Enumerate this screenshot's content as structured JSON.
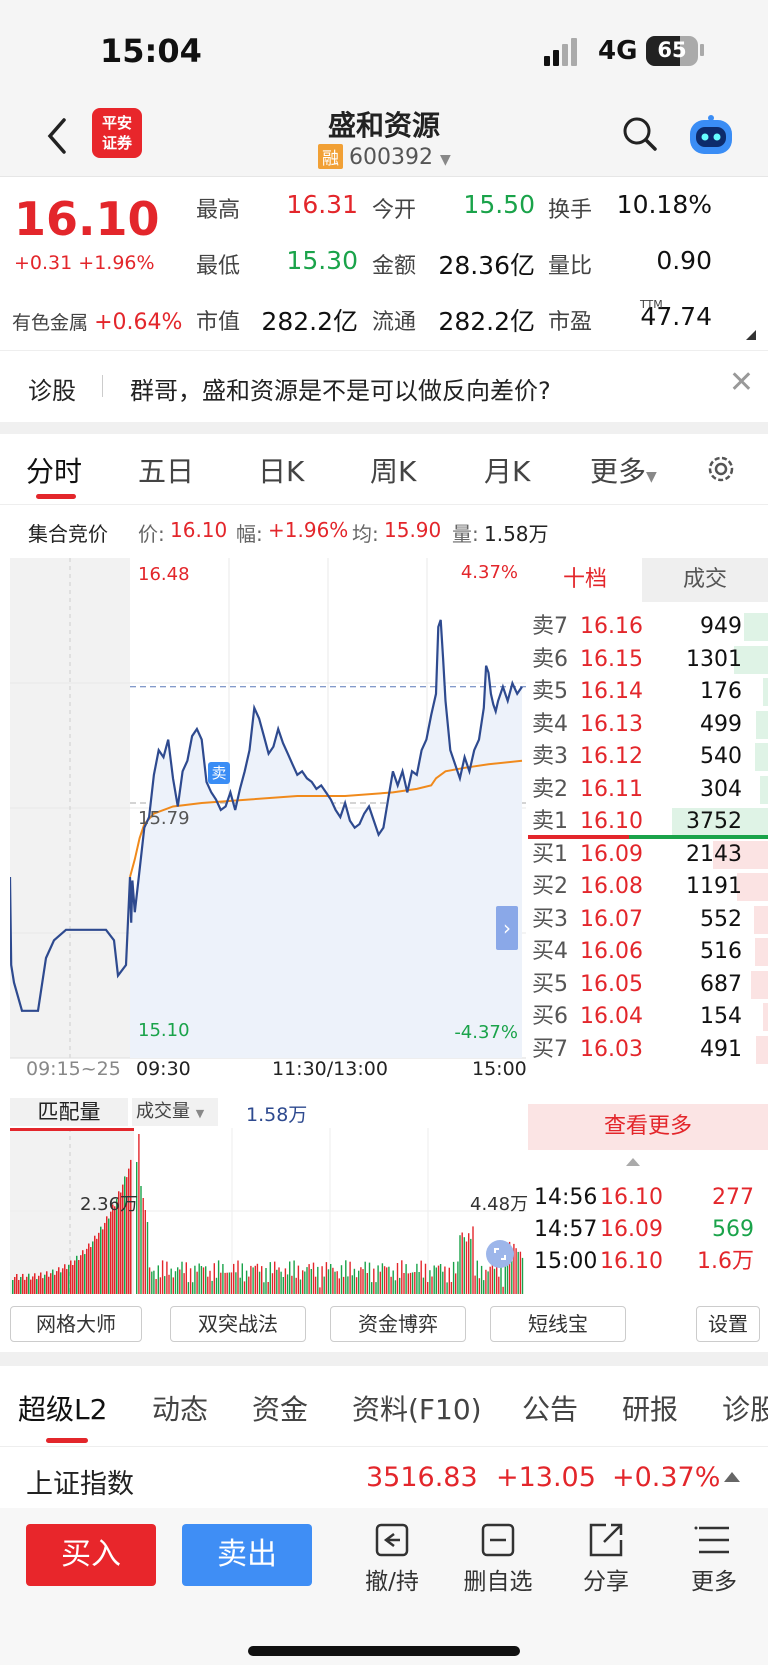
{
  "status_bar": {
    "time": "15:04",
    "network": "4G",
    "battery": "65",
    "battery_level_percent": 65
  },
  "header": {
    "stock_name": "盛和资源",
    "stock_code": "600392",
    "margin_badge": "融",
    "logo_text_line1": "平安",
    "logo_text_line2": "证券",
    "icons": [
      "back-arrow-icon",
      "search-icon",
      "robot-assistant-icon"
    ]
  },
  "quote": {
    "price": "16.10",
    "change": "+0.31",
    "change_pct": "+1.96%",
    "sector_name": "有色金属",
    "sector_change": "+0.64%",
    "fields": [
      {
        "label": "最高",
        "value": "16.31",
        "color": "red"
      },
      {
        "label": "今开",
        "value": "15.50",
        "color": "green"
      },
      {
        "label": "换手",
        "value": "10.18%",
        "color": "black"
      },
      {
        "label": "最低",
        "value": "15.30",
        "color": "green"
      },
      {
        "label": "金额",
        "value": "28.36亿",
        "color": "black"
      },
      {
        "label": "量比",
        "value": "0.90",
        "color": "black"
      },
      {
        "label": "市值",
        "value": "282.2亿",
        "color": "black"
      },
      {
        "label": "流通",
        "value": "282.2亿",
        "color": "black"
      },
      {
        "label": "市盈",
        "value": "47.74",
        "color": "black"
      }
    ],
    "pe_superscript": "TTM"
  },
  "hint": {
    "label": "诊股",
    "text": "群哥，盛和资源是不是可以做反向差价?"
  },
  "chart_tabs": [
    "分时",
    "五日",
    "日K",
    "周K",
    "月K",
    "更多"
  ],
  "auction": {
    "title": "集合竞价",
    "price_label": "价:",
    "price": "16.10",
    "range_label": "幅:",
    "range": "+1.96%",
    "avg_label": "均:",
    "avg": "15.90",
    "vol_label": "量:",
    "vol": "1.58万"
  },
  "chart_data": {
    "type": "line",
    "y_top_label": "16.48",
    "y_mid_label": "15.79",
    "y_bottom_label": "15.10",
    "pct_top_label": "4.37%",
    "pct_bottom_label": "-4.37%",
    "x_labels": [
      "09:15~25",
      "09:30",
      "11:30/13:00",
      "15:00"
    ],
    "ylim": [
      15.1,
      16.48
    ],
    "prev_close": 15.79,
    "marker_label": "卖",
    "price_series": [
      [
        0,
        15.58
      ],
      [
        0.3,
        15.33
      ],
      [
        1,
        15.28
      ],
      [
        3,
        15.2
      ],
      [
        7,
        15.2
      ],
      [
        9,
        15.35
      ],
      [
        11,
        15.4
      ],
      [
        14,
        15.43
      ],
      [
        20,
        15.43
      ],
      [
        24,
        15.43
      ],
      [
        26,
        15.4
      ],
      [
        27,
        15.3
      ],
      [
        29,
        15.33
      ],
      [
        30,
        15.58
      ],
      [
        30.5,
        15.45
      ],
      [
        31,
        15.57
      ],
      [
        32,
        15.48
      ],
      [
        34,
        15.6
      ],
      [
        36,
        15.72
      ],
      [
        38,
        15.75
      ],
      [
        40,
        15.87
      ],
      [
        42,
        15.94
      ],
      [
        44,
        15.92
      ],
      [
        46,
        15.97
      ],
      [
        48,
        15.86
      ],
      [
        50,
        15.78
      ],
      [
        52,
        15.88
      ],
      [
        54,
        15.91
      ],
      [
        56,
        15.98
      ],
      [
        58,
        16.0
      ],
      [
        60,
        15.97
      ],
      [
        62,
        15.85
      ],
      [
        64,
        15.82
      ],
      [
        66,
        15.8
      ],
      [
        68,
        15.77
      ],
      [
        70,
        15.78
      ],
      [
        72,
        15.82
      ],
      [
        74,
        15.77
      ],
      [
        76,
        15.83
      ],
      [
        78,
        15.88
      ],
      [
        80,
        15.94
      ],
      [
        82,
        16.06
      ],
      [
        84,
        16.03
      ],
      [
        86,
        15.98
      ],
      [
        88,
        15.93
      ],
      [
        90,
        15.95
      ],
      [
        92,
        16.0
      ],
      [
        94,
        15.96
      ],
      [
        96,
        15.93
      ],
      [
        98,
        15.9
      ],
      [
        100,
        15.87
      ],
      [
        102,
        15.88
      ],
      [
        104,
        15.86
      ],
      [
        106,
        15.85
      ],
      [
        108,
        15.83
      ],
      [
        110,
        15.84
      ],
      [
        112,
        15.82
      ],
      [
        114,
        15.8
      ],
      [
        116,
        15.77
      ],
      [
        118,
        15.75
      ],
      [
        120,
        15.79
      ],
      [
        122,
        15.74
      ],
      [
        124,
        15.72
      ],
      [
        126,
        15.73
      ],
      [
        128,
        15.76
      ],
      [
        130,
        15.78
      ],
      [
        132,
        15.74
      ],
      [
        134,
        15.7
      ],
      [
        136,
        15.72
      ],
      [
        138,
        15.8
      ],
      [
        140,
        15.88
      ],
      [
        142,
        15.84
      ],
      [
        144,
        15.88
      ],
      [
        146,
        15.82
      ],
      [
        148,
        15.88
      ],
      [
        150,
        15.87
      ],
      [
        152,
        15.94
      ],
      [
        154,
        15.97
      ],
      [
        156,
        16.04
      ],
      [
        158,
        16.1
      ],
      [
        159,
        16.29
      ],
      [
        160,
        16.31
      ],
      [
        161,
        16.2
      ],
      [
        162,
        16.08
      ],
      [
        164,
        15.94
      ],
      [
        166,
        15.9
      ],
      [
        168,
        15.86
      ],
      [
        170,
        15.92
      ],
      [
        172,
        15.88
      ],
      [
        174,
        15.94
      ],
      [
        176,
        15.97
      ],
      [
        178,
        16.06
      ],
      [
        179,
        16.18
      ],
      [
        180,
        16.16
      ],
      [
        181,
        16.1
      ],
      [
        182,
        16.07
      ],
      [
        183,
        16.05
      ],
      [
        184,
        16.08
      ],
      [
        186,
        16.12
      ],
      [
        188,
        16.08
      ],
      [
        190,
        16.13
      ],
      [
        192,
        16.1
      ],
      [
        194,
        16.12
      ]
    ],
    "avg_series": [
      [
        30,
        15.58
      ],
      [
        32,
        15.63
      ],
      [
        34,
        15.69
      ],
      [
        36,
        15.73
      ],
      [
        40,
        15.76
      ],
      [
        48,
        15.78
      ],
      [
        60,
        15.79
      ],
      [
        80,
        15.8
      ],
      [
        100,
        15.81
      ],
      [
        120,
        15.81
      ],
      [
        140,
        15.82
      ],
      [
        150,
        15.83
      ],
      [
        156,
        15.84
      ],
      [
        158,
        15.86
      ],
      [
        162,
        15.88
      ],
      [
        170,
        15.89
      ],
      [
        180,
        15.9
      ],
      [
        194,
        15.91
      ]
    ],
    "volume": {
      "label": "成交量",
      "value": "1.58万",
      "auction_label": "匹配量",
      "left_max_label": "2.36万",
      "right_max_label": "4.48万"
    }
  },
  "order_book": {
    "tabs": [
      "十档",
      "成交"
    ],
    "asks": [
      {
        "name": "卖7",
        "price": "16.16",
        "vol": "949",
        "bar": 0.25
      },
      {
        "name": "卖6",
        "price": "16.15",
        "vol": "1301",
        "bar": 0.35
      },
      {
        "name": "卖5",
        "price": "16.14",
        "vol": "176",
        "bar": 0.05
      },
      {
        "name": "卖4",
        "price": "16.13",
        "vol": "499",
        "bar": 0.13
      },
      {
        "name": "卖3",
        "price": "16.12",
        "vol": "540",
        "bar": 0.14
      },
      {
        "name": "卖2",
        "price": "16.11",
        "vol": "304",
        "bar": 0.08
      },
      {
        "name": "卖1",
        "price": "16.10",
        "vol": "3752",
        "bar": 1.0
      }
    ],
    "bids": [
      {
        "name": "买1",
        "price": "16.09",
        "vol": "2143",
        "bar": 0.57
      },
      {
        "name": "买2",
        "price": "16.08",
        "vol": "1191",
        "bar": 0.32
      },
      {
        "name": "买3",
        "price": "16.07",
        "vol": "552",
        "bar": 0.15
      },
      {
        "name": "买4",
        "price": "16.06",
        "vol": "516",
        "bar": 0.14
      },
      {
        "name": "买5",
        "price": "16.05",
        "vol": "687",
        "bar": 0.18
      },
      {
        "name": "买6",
        "price": "16.04",
        "vol": "154",
        "bar": 0.04
      },
      {
        "name": "买7",
        "price": "16.03",
        "vol": "491",
        "bar": 0.13
      }
    ],
    "more_label": "查看更多",
    "trades": [
      {
        "time": "14:56",
        "price": "16.10",
        "vol": "277",
        "color": "red"
      },
      {
        "time": "14:57",
        "price": "16.09",
        "vol": "569",
        "color": "green"
      },
      {
        "time": "15:00",
        "price": "16.10",
        "vol": "1.6万",
        "color": "red"
      }
    ]
  },
  "tools": [
    "网格大师",
    "双突战法",
    "资金博弈",
    "短线宝",
    "设置"
  ],
  "bottom_tabs": [
    "超级L2",
    "动态",
    "资金",
    "资料(F10)",
    "公告",
    "研报",
    "诊股"
  ],
  "index_bar": {
    "name": "上证指数",
    "value": "3516.83",
    "change": "+13.05",
    "change_pct": "+0.37%"
  },
  "actions": {
    "buy": "买入",
    "sell": "卖出",
    "items": [
      {
        "label": "撤/持",
        "icon": "withdraw-icon"
      },
      {
        "label": "删自选",
        "icon": "remove-watchlist-icon"
      },
      {
        "label": "分享",
        "icon": "share-icon"
      },
      {
        "label": "更多",
        "icon": "menu-icon"
      }
    ]
  },
  "colors": {
    "up": "#e3262b",
    "down": "#1aa34a",
    "price_line": "#2e4a8f",
    "avg_line": "#f08a1c",
    "sell_button": "#3f8ef5"
  }
}
